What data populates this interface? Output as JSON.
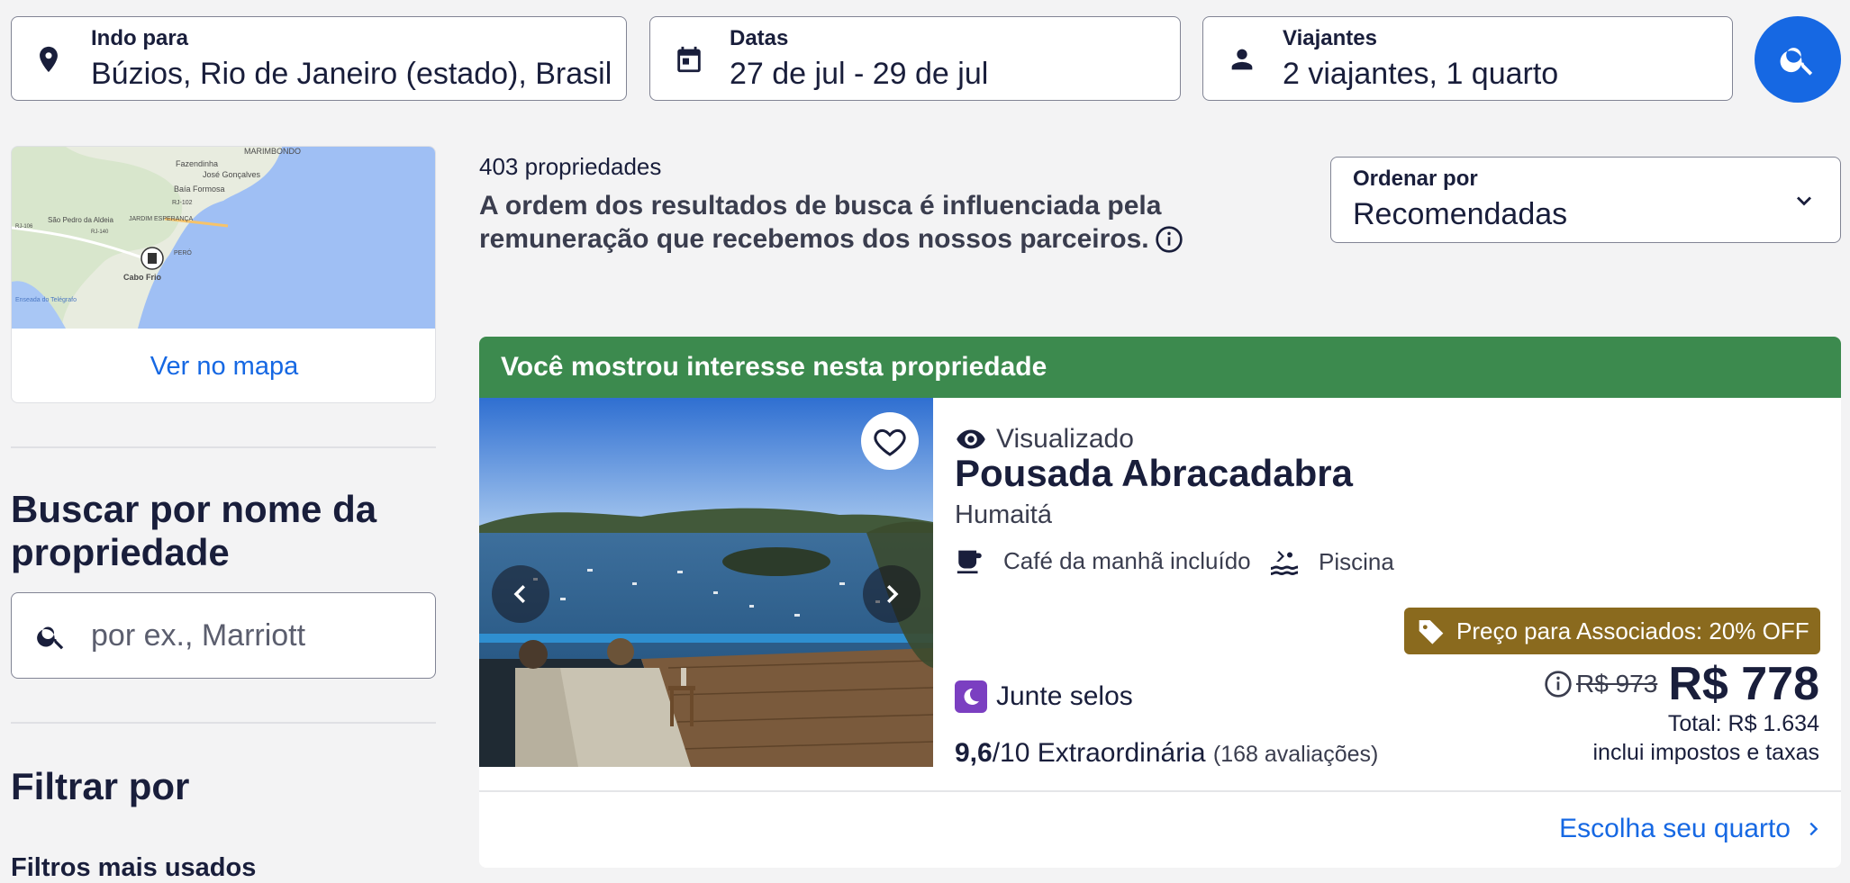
{
  "search": {
    "destination": {
      "label": "Indo para",
      "value": "Búzios, Rio de Janeiro (estado), Brasil",
      "icon": "location-pin-icon"
    },
    "dates": {
      "label": "Datas",
      "value": "27 de jul - 29 de jul",
      "icon": "calendar-icon"
    },
    "travelers": {
      "label": "Viajantes",
      "value": "2 viajantes, 1 quarto",
      "icon": "person-icon"
    },
    "submit_icon": "search-icon",
    "accent_color": "#1668e3"
  },
  "sidebar": {
    "map": {
      "link_label": "Ver no mapa",
      "labels": [
        "Fazendinha",
        "MARIMBONDO",
        "José Gonçalves",
        "Baía Formosa",
        "RJ-102",
        "JARDIM ESPERANÇA",
        "São Pedro da Aldeia",
        "RJ-106",
        "RJ-140",
        "PERÓ",
        "Cabo Frio",
        "Enseada do Telégrafo"
      ]
    },
    "name_search": {
      "heading": "Buscar por nome da propriedade",
      "placeholder": "por ex., Marriott"
    },
    "filter_heading": "Filtrar por",
    "filter_subheading": "Filtros mais usados"
  },
  "results": {
    "count": "403 propriedades",
    "disclaimer": "A ordem dos resultados de busca é influenciada pela remuneração que recebemos dos nossos parceiros.",
    "sort": {
      "label": "Ordenar por",
      "value": "Recomendadas"
    }
  },
  "listing": {
    "banner": "Você mostrou interesse nesta propriedade",
    "banner_color": "#3c8a4e",
    "viewed": "Visualizado",
    "name": "Pousada Abracadabra",
    "area": "Humaitá",
    "amenities": [
      {
        "icon": "coffee-cup-icon",
        "label": "Café da manhã incluído"
      },
      {
        "icon": "pool-icon",
        "label": "Piscina"
      }
    ],
    "loyalty": "Junte selos",
    "rating": {
      "score": "9,6",
      "scale": "/10",
      "descriptor": "Extraordinária",
      "reviews": "(168 avaliações)"
    },
    "member_badge": "Preço para Associados: 20% OFF",
    "member_badge_color": "#8a6a1e",
    "old_price": "R$ 973",
    "price": "R$ 778",
    "total": "Total: R$ 1.634",
    "taxes": "inclui impostos e taxas",
    "cta": "Escolha seu quarto"
  }
}
